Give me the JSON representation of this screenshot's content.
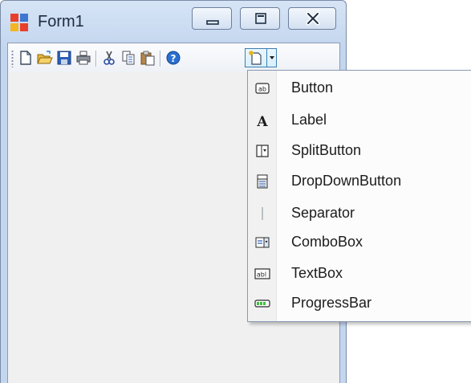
{
  "window": {
    "title": "Form1",
    "minimize_label": "Minimize",
    "maximize_label": "Maximize",
    "close_label": "Close"
  },
  "toolbar": {
    "items": [
      {
        "name": "new-icon"
      },
      {
        "name": "open-folder-icon"
      },
      {
        "name": "save-icon"
      },
      {
        "name": "print-icon"
      },
      {
        "name": "cut-icon"
      },
      {
        "name": "copy-icon"
      },
      {
        "name": "paste-icon"
      },
      {
        "name": "help-icon"
      },
      {
        "name": "add-item-split-button"
      }
    ]
  },
  "dropdown": {
    "items": [
      {
        "label": "Button",
        "icon": "button-icon"
      },
      {
        "label": "Label",
        "icon": "label-icon"
      },
      {
        "label": "SplitButton",
        "icon": "split-button-icon"
      },
      {
        "label": "DropDownButton",
        "icon": "dropdown-button-icon"
      },
      {
        "label": "Separator",
        "icon": "separator-icon"
      },
      {
        "label": "ComboBox",
        "icon": "combobox-icon"
      },
      {
        "label": "TextBox",
        "icon": "textbox-icon"
      },
      {
        "label": "ProgressBar",
        "icon": "progressbar-icon"
      }
    ]
  },
  "colors": {
    "accent": "#3c7fb1",
    "titlebar": "#c3d6ef",
    "client": "#f0f0f0"
  }
}
